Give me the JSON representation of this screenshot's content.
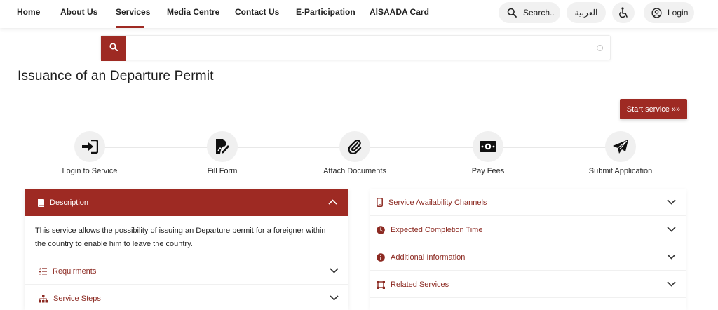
{
  "nav": {
    "items": [
      "Home",
      "About Us",
      "Services",
      "Media Centre",
      "Contact Us",
      "E-Participation",
      "AlSAADA Card"
    ],
    "active": "Services",
    "search_label": "Search..",
    "language_label": "العربية",
    "login_label": "Login"
  },
  "search": {
    "value": "",
    "placeholder": ""
  },
  "page": {
    "title": "Issuance of an Departure Permit",
    "start_button": "Start service »»"
  },
  "steps": [
    {
      "label": "Login to Service",
      "icon": "login-icon"
    },
    {
      "label": "Fill Form",
      "icon": "fill-form-icon"
    },
    {
      "label": "Attach Documents",
      "icon": "paperclip-icon"
    },
    {
      "label": "Pay Fees",
      "icon": "money-icon"
    },
    {
      "label": "Submit Application",
      "icon": "paper-plane-icon"
    }
  ],
  "left_accordion": {
    "open": {
      "title": "Description",
      "body": "This service allows the possibility of issuing an Departure permit for a foreigner within the country to enable him to leave the country."
    },
    "items": [
      {
        "label": "Requirments",
        "icon": "list-icon"
      },
      {
        "label": "Service Steps",
        "icon": "sitemap-icon"
      }
    ]
  },
  "right_accordion": {
    "items": [
      {
        "label": "Service Availability Channels",
        "icon": "mobile-icon"
      },
      {
        "label": "Expected Completion Time",
        "icon": "clock-icon"
      },
      {
        "label": "Additional Information",
        "icon": "info-icon"
      },
      {
        "label": "Related Services",
        "icon": "link-icon"
      }
    ]
  },
  "colors": {
    "accent": "#9e2a23",
    "accent_text": "#8c2a22",
    "pill_bg": "#f1f1f1",
    "step_bg": "#f0f0f0"
  }
}
